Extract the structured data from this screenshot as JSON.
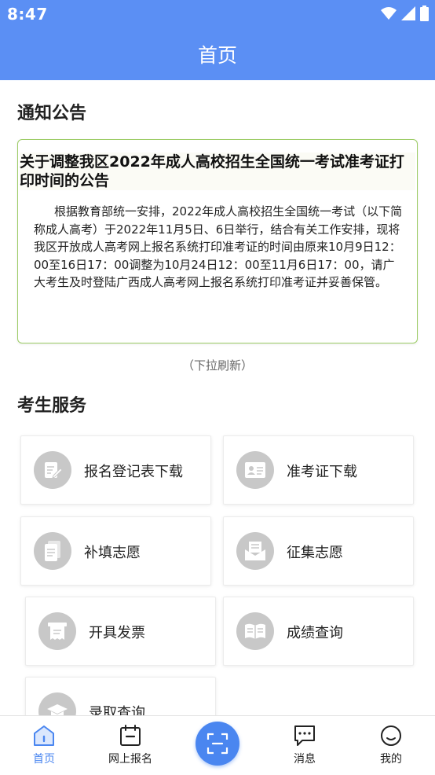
{
  "status_bar": {
    "time": "8:47"
  },
  "header": {
    "title": "首页"
  },
  "notice": {
    "section_title": "通知公告",
    "title": "关于调整我区2022年成人高校招生全国统一考试准考证打印时间的公告",
    "body": "根据教育部统一安排，2022年成人高校招生全国统一考试（以下简称成人高考）于2022年11月5日、6日举行，结合有关工作安排，现将我区开放成人高考网上报名系统打印准考证的时间由原来10月9日12：00至16日17：00调整为10月24日12：00至11月6日17：00，请广大考生及时登陆广西成人高考网上报名系统打印准考证并妥善保管。",
    "refresh_hint": "（下拉刷新）"
  },
  "services": {
    "section_title": "考生服务",
    "items": [
      {
        "label": "报名登记表下载",
        "icon": "form-edit-icon"
      },
      {
        "label": "准考证下载",
        "icon": "id-card-icon"
      },
      {
        "label": "补填志愿",
        "icon": "document-icon"
      },
      {
        "label": "征集志愿",
        "icon": "mail-icon"
      },
      {
        "label": "开具发票",
        "icon": "invoice-icon"
      },
      {
        "label": "成绩查询",
        "icon": "open-book-icon"
      },
      {
        "label": "录取查询",
        "icon": "graduation-cap-icon"
      }
    ]
  },
  "bottom_nav": {
    "items": [
      {
        "label": "首页",
        "icon": "home-icon",
        "active": true
      },
      {
        "label": "网上报名",
        "icon": "calendar-icon"
      },
      {
        "label": "",
        "icon": "scan-icon"
      },
      {
        "label": "消息",
        "icon": "message-icon"
      },
      {
        "label": "我的",
        "icon": "profile-icon"
      }
    ]
  },
  "colors": {
    "primary": "#5b8ff4",
    "nav_active": "#4a86f0",
    "notice_border": "#9ccc65",
    "icon_circle": "#c8c8c8"
  }
}
